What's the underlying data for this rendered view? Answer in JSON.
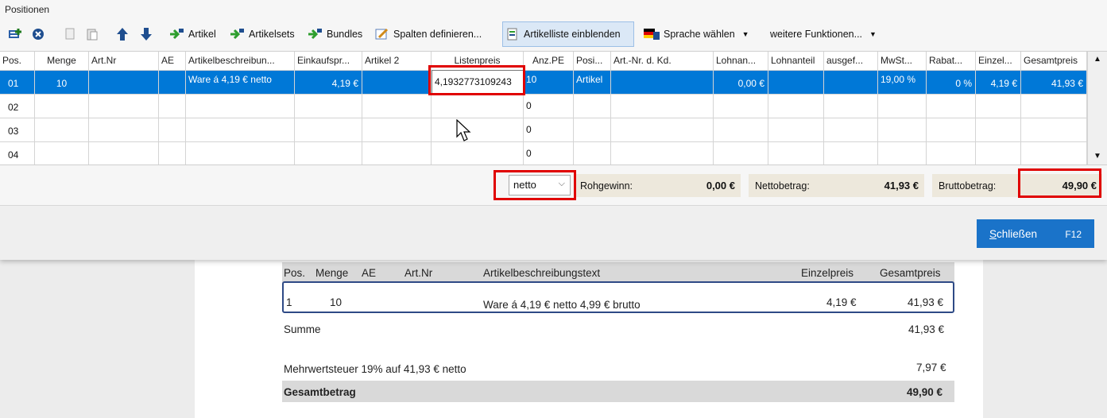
{
  "section_title": "Positionen",
  "toolbar": {
    "artikel": "Artikel",
    "artikelsets": "Artikelsets",
    "bundles": "Bundles",
    "spalten": "Spalten definieren...",
    "artikelliste": "Artikelliste einblenden",
    "sprache": "Sprache wählen",
    "weitere": "weitere Funktionen..."
  },
  "grid": {
    "headers": {
      "pos": "Pos.",
      "menge": "Menge",
      "artnr": "Art.Nr",
      "ae": "AE",
      "beschreibung": "Artikelbeschreibun...",
      "einkauf": "Einkaufspr...",
      "artikel2": "Artikel 2",
      "listenpreis": "Listenpreis",
      "anzpe": "Anz.PE",
      "posi": "Posi...",
      "artnrkd": "Art.-Nr. d. Kd.",
      "lohnan": "Lohnan...",
      "lohnanteil": "Lohnanteil",
      "ausgef": "ausgef...",
      "mwst": "MwSt...",
      "rabat": "Rabat...",
      "einzel": "Einzel...",
      "gesamtpreis": "Gesamtpreis"
    },
    "row1": {
      "pos": "01",
      "menge": "10",
      "beschreibung": "Ware á 4,19 € netto",
      "einkauf": "4,19 €",
      "listenpreis_edit": "4,1932773109243",
      "anzpe": "10",
      "posi": "Artikel",
      "lohnan": "0,00 €",
      "mwst": "19,00 %",
      "rabat": "0 %",
      "einzel": "4,19 €",
      "gesamt": "41,93 €"
    },
    "row2": {
      "pos": "02",
      "anzpe": "0"
    },
    "row3": {
      "pos": "03",
      "anzpe": "0"
    },
    "row4": {
      "pos": "04",
      "anzpe": "0"
    }
  },
  "summary": {
    "mode_select": "netto",
    "rohgewinn_label": "Rohgewinn:",
    "rohgewinn_value": "0,00 €",
    "netto_label": "Nettobetrag:",
    "netto_value": "41,93 €",
    "brutto_label": "Bruttobetrag:",
    "brutto_value": "49,90 €"
  },
  "close_button": {
    "label_first": "S",
    "label_rest": "chließen",
    "shortcut": "F12"
  },
  "doc": {
    "hdr_pos": "Pos.",
    "hdr_menge": "Menge",
    "hdr_ae": "AE",
    "hdr_artnr": "Art.Nr",
    "hdr_text": "Artikelbeschreibungstext",
    "hdr_einzel": "Einzelpreis",
    "hdr_gesamt": "Gesamtpreis",
    "row_pos": "1",
    "row_menge": "10",
    "row_text": "Ware á 4,19 € netto 4,99 € brutto",
    "row_einzel": "4,19 €",
    "row_gesamt": "41,93 €",
    "summe_label": "Summe",
    "summe_value": "41,93 €",
    "mwst_label": "Mehrwertsteuer 19% auf 41,93 € netto",
    "mwst_value": "7,97 €",
    "total_label": "Gesamtbetrag",
    "total_value": "49,90 €"
  },
  "colors": {
    "selection": "#0078d7",
    "highlight": "#e00000",
    "button": "#1a73c9"
  }
}
